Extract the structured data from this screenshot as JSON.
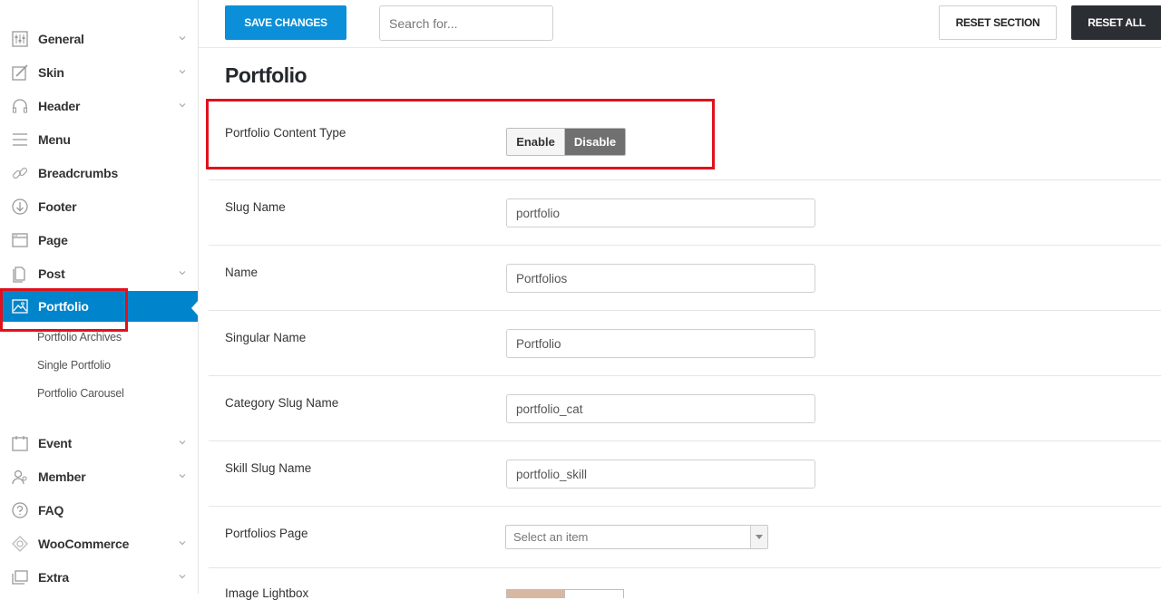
{
  "sidebar": {
    "items": [
      {
        "label": "General",
        "icon": "sliders-icon",
        "chevron": true
      },
      {
        "label": "Skin",
        "icon": "brush-icon",
        "chevron": true
      },
      {
        "label": "Header",
        "icon": "headphones-icon",
        "chevron": true
      },
      {
        "label": "Menu",
        "icon": "menu-icon",
        "chevron": false
      },
      {
        "label": "Breadcrumbs",
        "icon": "link-icon",
        "chevron": false
      },
      {
        "label": "Footer",
        "icon": "arrow-down-circle-icon",
        "chevron": false
      },
      {
        "label": "Page",
        "icon": "browser-window-icon",
        "chevron": false
      },
      {
        "label": "Post",
        "icon": "documents-icon",
        "chevron": true
      },
      {
        "label": "Portfolio",
        "icon": "image-icon",
        "chevron": false,
        "active": true
      },
      {
        "label": "Event",
        "icon": "calendar-icon",
        "chevron": true
      },
      {
        "label": "Member",
        "icon": "users-icon",
        "chevron": true
      },
      {
        "label": "FAQ",
        "icon": "question-circle-icon",
        "chevron": false
      },
      {
        "label": "WooCommerce",
        "icon": "woocommerce-icon",
        "chevron": true
      },
      {
        "label": "Extra",
        "icon": "layers-icon",
        "chevron": true
      }
    ],
    "subitems": [
      "Portfolio Archives",
      "Single Portfolio",
      "Portfolio Carousel"
    ]
  },
  "toolbar": {
    "save_label": "SAVE CHANGES",
    "search_placeholder": "Search for...",
    "reset_section_label": "RESET SECTION",
    "reset_all_label": "RESET ALL"
  },
  "main": {
    "title": "Portfolio",
    "content_type": {
      "label": "Portfolio Content Type",
      "enable": "Enable",
      "disable": "Disable",
      "selected": "Disable"
    },
    "slug": {
      "label": "Slug Name",
      "value": "portfolio"
    },
    "name": {
      "label": "Name",
      "value": "Portfolios"
    },
    "singular": {
      "label": "Singular Name",
      "value": "Portfolio"
    },
    "category_slug": {
      "label": "Category Slug Name",
      "value": "portfolio_cat"
    },
    "skill_slug": {
      "label": "Skill Slug Name",
      "value": "portfolio_skill"
    },
    "portfolios_page": {
      "label": "Portfolios Page",
      "placeholder": "Select an item"
    },
    "lightbox": {
      "label": "Image Lightbox"
    }
  },
  "colors": {
    "accent": "#0b8fd8",
    "active_nav": "#0084cc",
    "dark_button": "#2b2f33",
    "highlight": "#e0111b"
  }
}
